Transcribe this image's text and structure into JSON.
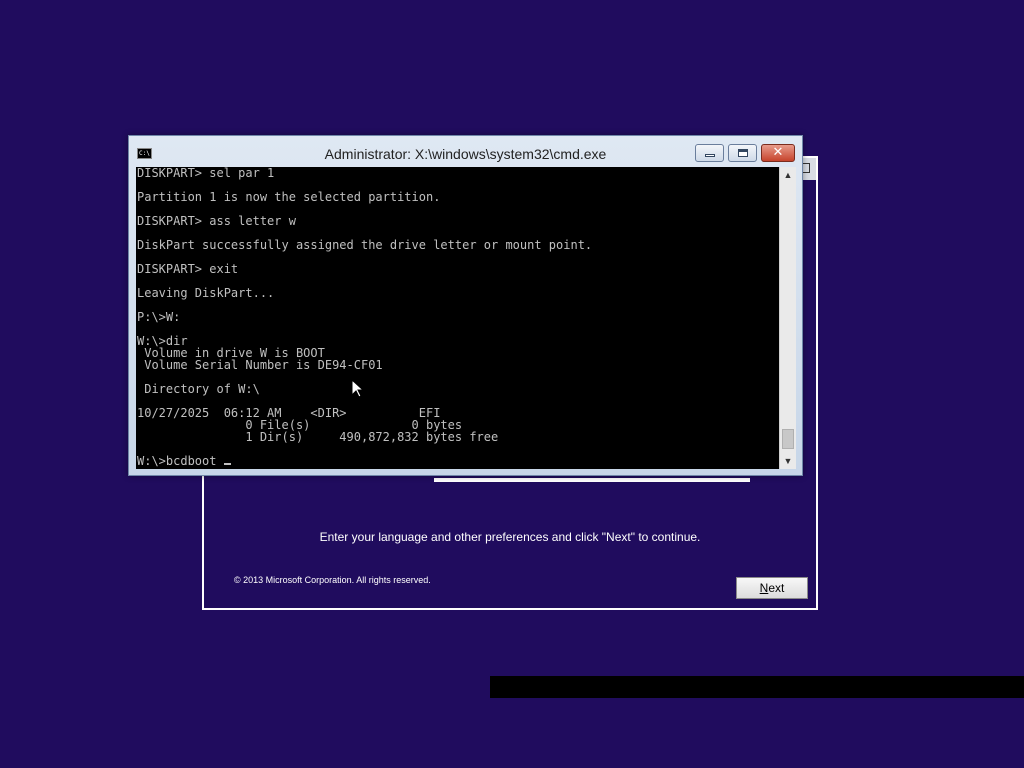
{
  "cmd": {
    "title": "Administrator: X:\\windows\\system32\\cmd.exe",
    "icon_label": "C:\\",
    "close_glyph": "✕",
    "console_lines": [
      "DISKPART> sel par 1",
      "",
      "Partition 1 is now the selected partition.",
      "",
      "DISKPART> ass letter w",
      "",
      "DiskPart successfully assigned the drive letter or mount point.",
      "",
      "DISKPART> exit",
      "",
      "Leaving DiskPart...",
      "",
      "P:\\>W:",
      "",
      "W:\\>dir",
      " Volume in drive W is BOOT",
      " Volume Serial Number is DE94-CF01",
      "",
      " Directory of W:\\",
      "",
      "10/27/2025  06:12 AM    <DIR>          EFI",
      "               0 File(s)              0 bytes",
      "               1 Dir(s)     490,872,832 bytes free",
      ""
    ],
    "prompt_line": "W:\\>bcdboot ",
    "scroll_up_glyph": "▲",
    "scroll_down_glyph": "▼"
  },
  "setup": {
    "instructions": "Enter your language and other preferences and click \"Next\" to continue.",
    "copyright": "© 2013 Microsoft Corporation. All rights reserved.",
    "next_label_underlined": "N",
    "next_label_rest": "ext"
  },
  "colors": {
    "desktop_bg": "#200c5e",
    "console_bg": "#000000",
    "console_text": "#c0c0c0",
    "close_button": "#c6442c"
  },
  "icons": {
    "cmd": "cmd-icon",
    "minimize": "minimize-icon",
    "maximize": "maximize-icon",
    "close": "close-icon",
    "pointer": "mouse-pointer-icon"
  }
}
